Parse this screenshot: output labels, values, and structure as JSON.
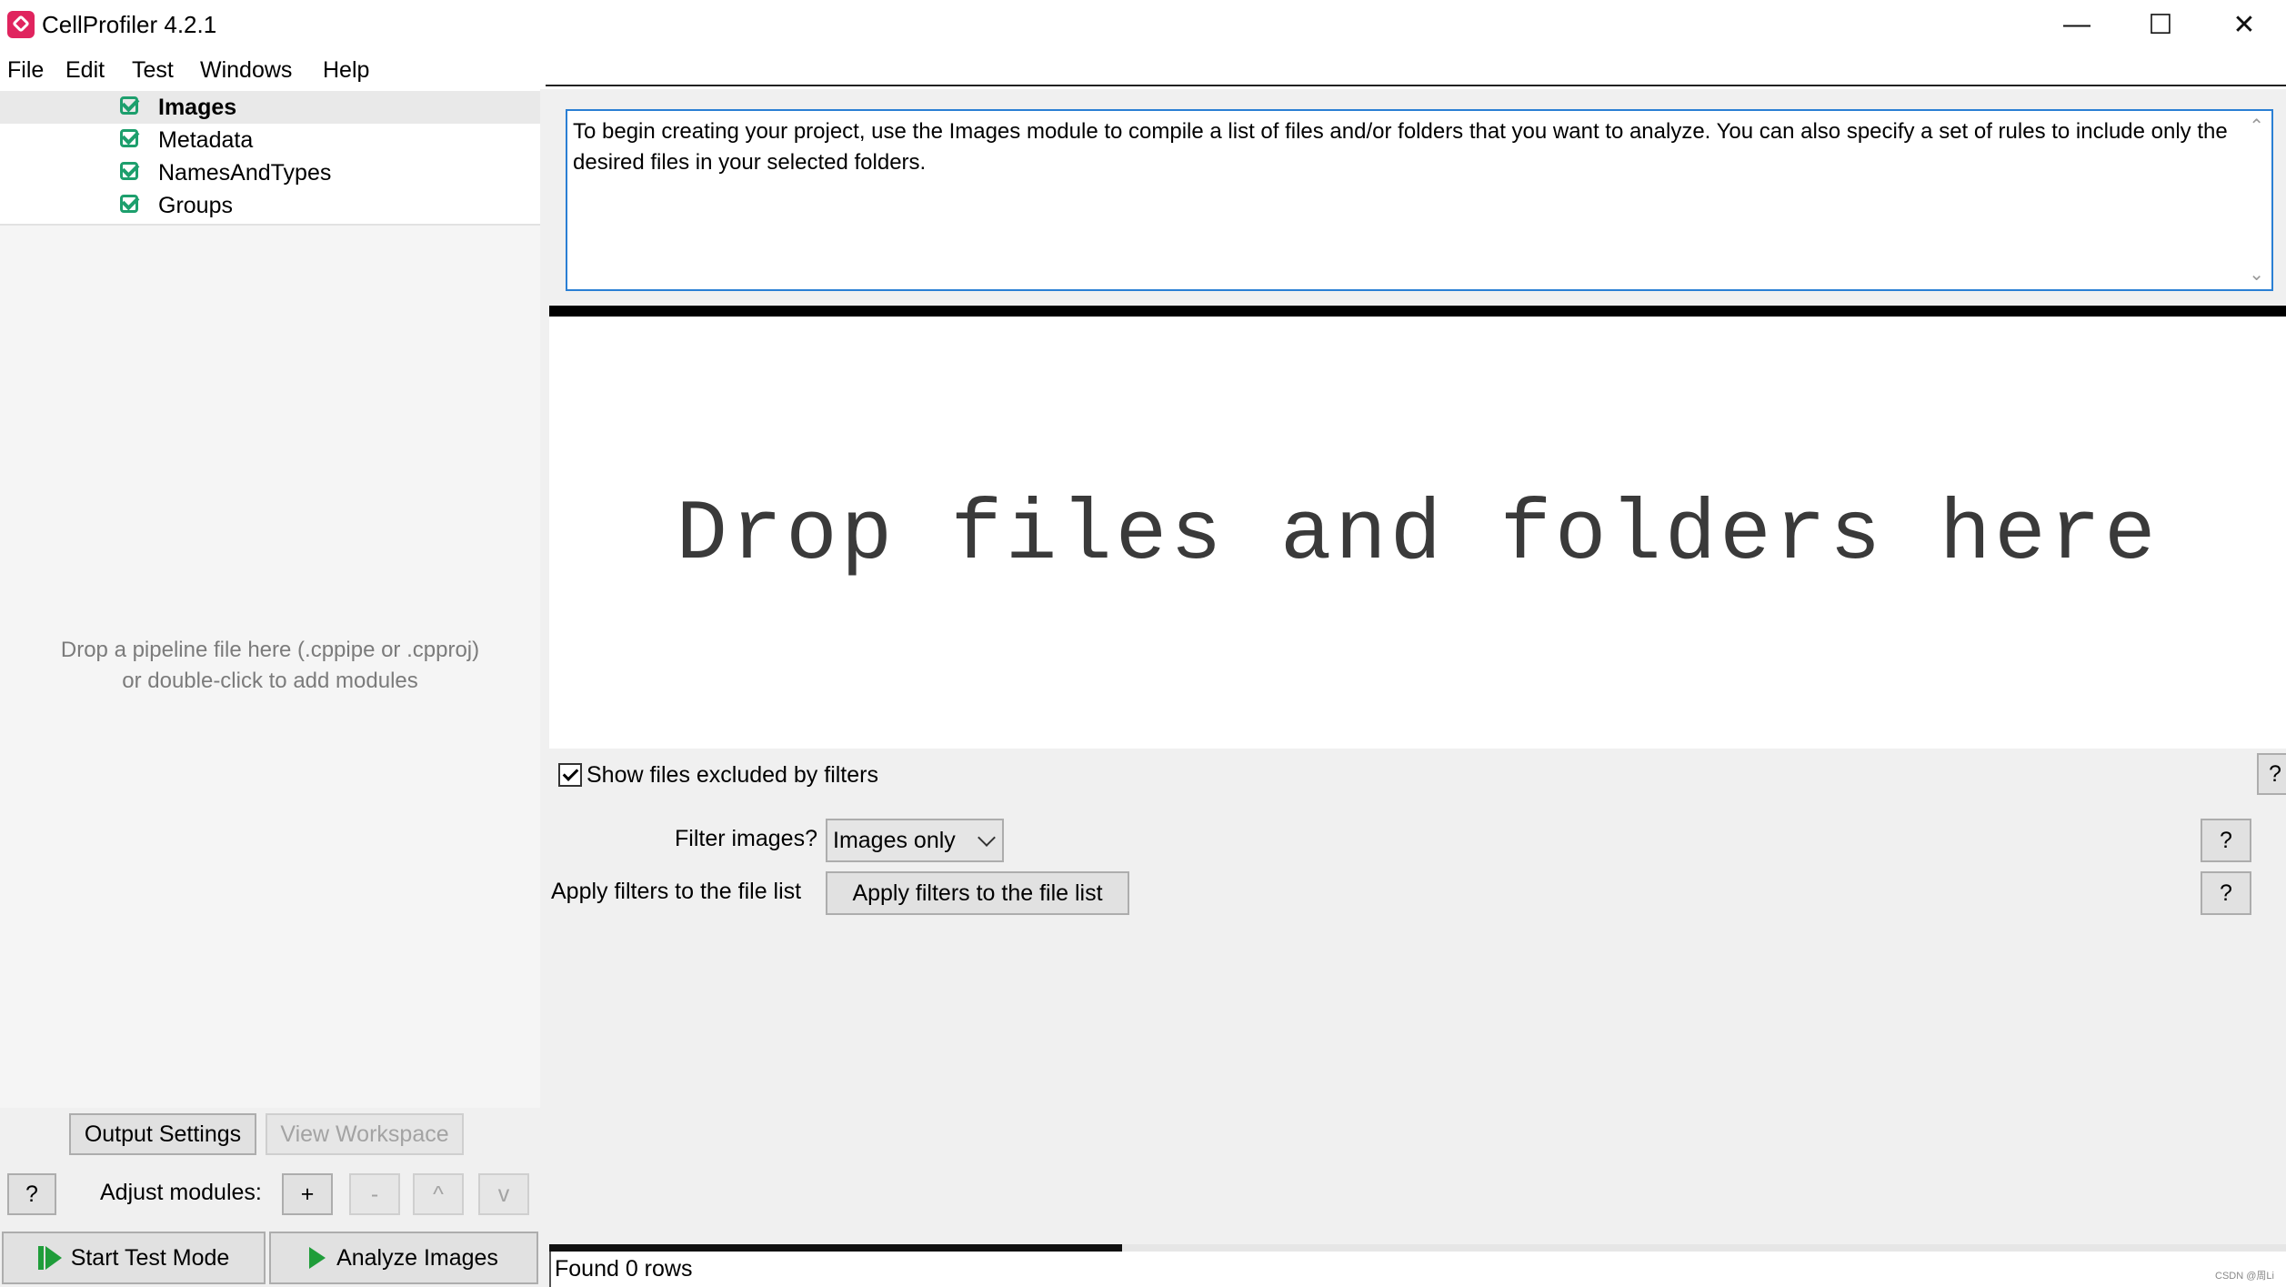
{
  "window": {
    "title": "CellProfiler 4.2.1",
    "minimize_glyph": "—",
    "maximize_glyph": "☐",
    "close_glyph": "✕"
  },
  "menu": [
    "File",
    "Edit",
    "Test",
    "Windows",
    "Help"
  ],
  "modules": [
    {
      "label": "Images",
      "selected": true,
      "enabled": true
    },
    {
      "label": "Metadata",
      "selected": false,
      "enabled": true
    },
    {
      "label": "NamesAndTypes",
      "selected": false,
      "enabled": true
    },
    {
      "label": "Groups",
      "selected": false,
      "enabled": true
    }
  ],
  "pipeline_drop": {
    "line1": "Drop a pipeline file here (.cppipe or .cpproj)",
    "line2": "or double-click to add modules"
  },
  "left_buttons": {
    "output_settings": "Output Settings",
    "view_workspace": "View Workspace",
    "help": "?",
    "adjust_label": "Adjust modules:",
    "add": "+",
    "remove": "-",
    "up": "^",
    "down": "v",
    "start_test": "Start Test Mode",
    "analyze": "Analyze Images"
  },
  "help_text": "To begin creating your project, use the Images module to compile a list of files and/or folders that you want to analyze. You can also specify a set of rules to include only the desired files in your selected folders.",
  "drop_area_text": "Drop files and folders here",
  "settings": {
    "show_excluded_label": "Show files excluded by filters",
    "show_excluded_checked": true,
    "filter_label": "Filter images?",
    "filter_value": "Images only",
    "apply_label": "Apply filters to the file list",
    "apply_button": "Apply filters to the file list",
    "help_button": "?"
  },
  "progress_fraction": 0.33,
  "status": "Found 0 rows",
  "watermark": "CSDN @周Li"
}
